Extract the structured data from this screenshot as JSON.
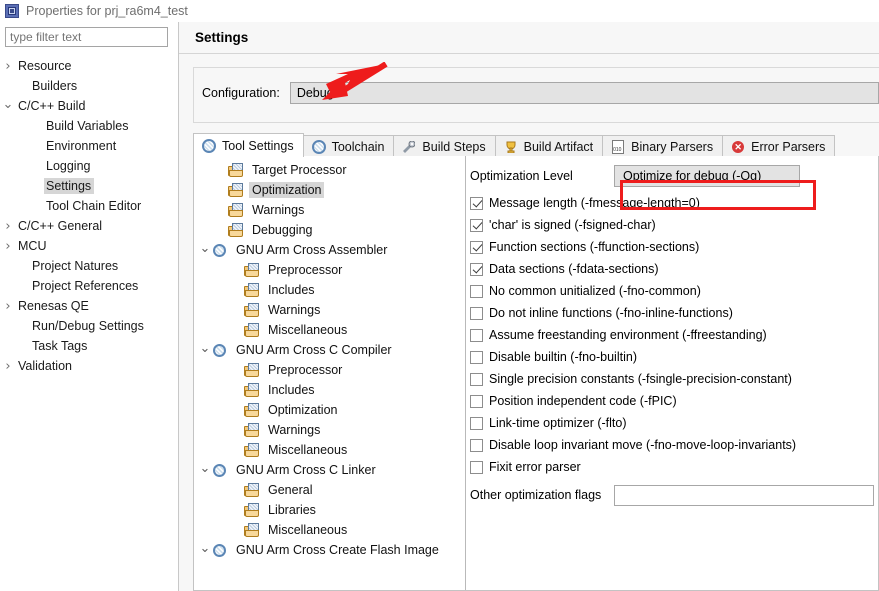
{
  "window": {
    "title": "Properties for prj_ra6m4_test",
    "icon": "chip-icon"
  },
  "filter": {
    "placeholder": "type filter text",
    "value": ""
  },
  "sidebar": {
    "items": [
      {
        "label": "Resource",
        "twisty": "collapsed",
        "indent": 0,
        "selected": false
      },
      {
        "label": "Builders",
        "twisty": "none",
        "indent": 1,
        "selected": false
      },
      {
        "label": "C/C++ Build",
        "twisty": "expanded",
        "indent": 0,
        "selected": false
      },
      {
        "label": "Build Variables",
        "twisty": "none",
        "indent": 2,
        "selected": false
      },
      {
        "label": "Environment",
        "twisty": "none",
        "indent": 2,
        "selected": false
      },
      {
        "label": "Logging",
        "twisty": "none",
        "indent": 2,
        "selected": false
      },
      {
        "label": "Settings",
        "twisty": "none",
        "indent": 2,
        "selected": true
      },
      {
        "label": "Tool Chain Editor",
        "twisty": "none",
        "indent": 2,
        "selected": false
      },
      {
        "label": "C/C++ General",
        "twisty": "collapsed",
        "indent": 0,
        "selected": false
      },
      {
        "label": "MCU",
        "twisty": "collapsed",
        "indent": 0,
        "selected": false
      },
      {
        "label": "Project Natures",
        "twisty": "none",
        "indent": 1,
        "selected": false
      },
      {
        "label": "Project References",
        "twisty": "none",
        "indent": 1,
        "selected": false
      },
      {
        "label": "Renesas QE",
        "twisty": "collapsed",
        "indent": 0,
        "selected": false
      },
      {
        "label": "Run/Debug Settings",
        "twisty": "none",
        "indent": 1,
        "selected": false
      },
      {
        "label": "Task Tags",
        "twisty": "none",
        "indent": 1,
        "selected": false
      },
      {
        "label": "Validation",
        "twisty": "collapsed",
        "indent": 0,
        "selected": false
      }
    ]
  },
  "header": {
    "title": "Settings"
  },
  "configuration": {
    "label": "Configuration:",
    "value": "Debug"
  },
  "tabs": [
    {
      "label": "Tool Settings",
      "icon": "gear-icon",
      "active": true
    },
    {
      "label": "Toolchain",
      "icon": "gear-icon",
      "active": false
    },
    {
      "label": "Build Steps",
      "icon": "wrench-icon",
      "active": false
    },
    {
      "label": "Build Artifact",
      "icon": "trophy-icon",
      "active": false
    },
    {
      "label": "Binary Parsers",
      "icon": "binary-icon",
      "active": false
    },
    {
      "label": "Error Parsers",
      "icon": "error-icon",
      "active": false
    }
  ],
  "tool_tree": [
    {
      "label": "Target Processor",
      "icon": "folder-page-icon",
      "indent": 1,
      "twisty": "none",
      "selected": false
    },
    {
      "label": "Optimization",
      "icon": "folder-page-icon",
      "indent": 1,
      "twisty": "none",
      "selected": true
    },
    {
      "label": "Warnings",
      "icon": "folder-page-icon",
      "indent": 1,
      "twisty": "none",
      "selected": false
    },
    {
      "label": "Debugging",
      "icon": "folder-page-icon",
      "indent": 1,
      "twisty": "none",
      "selected": false
    },
    {
      "label": "GNU Arm Cross Assembler",
      "icon": "tool-icon",
      "indent": 0,
      "twisty": "expanded",
      "selected": false
    },
    {
      "label": "Preprocessor",
      "icon": "folder-page-icon",
      "indent": 2,
      "twisty": "none",
      "selected": false
    },
    {
      "label": "Includes",
      "icon": "folder-page-icon",
      "indent": 2,
      "twisty": "none",
      "selected": false
    },
    {
      "label": "Warnings",
      "icon": "folder-page-icon",
      "indent": 2,
      "twisty": "none",
      "selected": false
    },
    {
      "label": "Miscellaneous",
      "icon": "folder-page-icon",
      "indent": 2,
      "twisty": "none",
      "selected": false
    },
    {
      "label": "GNU Arm Cross C Compiler",
      "icon": "tool-icon",
      "indent": 0,
      "twisty": "expanded",
      "selected": false
    },
    {
      "label": "Preprocessor",
      "icon": "folder-page-icon",
      "indent": 2,
      "twisty": "none",
      "selected": false
    },
    {
      "label": "Includes",
      "icon": "folder-page-icon",
      "indent": 2,
      "twisty": "none",
      "selected": false
    },
    {
      "label": "Optimization",
      "icon": "folder-page-icon",
      "indent": 2,
      "twisty": "none",
      "selected": false
    },
    {
      "label": "Warnings",
      "icon": "folder-page-icon",
      "indent": 2,
      "twisty": "none",
      "selected": false
    },
    {
      "label": "Miscellaneous",
      "icon": "folder-page-icon",
      "indent": 2,
      "twisty": "none",
      "selected": false
    },
    {
      "label": "GNU Arm Cross C Linker",
      "icon": "tool-icon",
      "indent": 0,
      "twisty": "expanded",
      "selected": false
    },
    {
      "label": "General",
      "icon": "folder-page-icon",
      "indent": 2,
      "twisty": "none",
      "selected": false
    },
    {
      "label": "Libraries",
      "icon": "folder-page-icon",
      "indent": 2,
      "twisty": "none",
      "selected": false
    },
    {
      "label": "Miscellaneous",
      "icon": "folder-page-icon",
      "indent": 2,
      "twisty": "none",
      "selected": false
    },
    {
      "label": "GNU Arm Cross Create Flash Image",
      "icon": "tool-icon",
      "indent": 0,
      "twisty": "expanded",
      "selected": false
    }
  ],
  "settings": {
    "optimization_level": {
      "label": "Optimization Level",
      "value": "Optimize for debug (-Og)"
    },
    "checkboxes": [
      {
        "label": "Message length (-fmessage-length=0)",
        "checked": true
      },
      {
        "label": "'char' is signed (-fsigned-char)",
        "checked": true
      },
      {
        "label": "Function sections (-ffunction-sections)",
        "checked": true
      },
      {
        "label": "Data sections (-fdata-sections)",
        "checked": true
      },
      {
        "label": "No common unitialized (-fno-common)",
        "checked": false
      },
      {
        "label": "Do not inline functions (-fno-inline-functions)",
        "checked": false
      },
      {
        "label": "Assume freestanding environment (-ffreestanding)",
        "checked": false
      },
      {
        "label": "Disable builtin (-fno-builtin)",
        "checked": false
      },
      {
        "label": "Single precision constants (-fsingle-precision-constant)",
        "checked": false
      },
      {
        "label": "Position independent code (-fPIC)",
        "checked": false
      },
      {
        "label": "Link-time optimizer (-flto)",
        "checked": false
      },
      {
        "label": "Disable loop invariant move (-fno-move-loop-invariants)",
        "checked": false
      },
      {
        "label": "Fixit error parser",
        "checked": false
      }
    ],
    "other_flags": {
      "label": "Other optimization flags",
      "value": "",
      "placeholder": ""
    }
  },
  "annotations": {
    "arrow_color": "#ee1c1c",
    "box_color": "#ee1c1c",
    "arrow_target": "Debug",
    "box_target": "Optimize for debug (-Og)"
  }
}
